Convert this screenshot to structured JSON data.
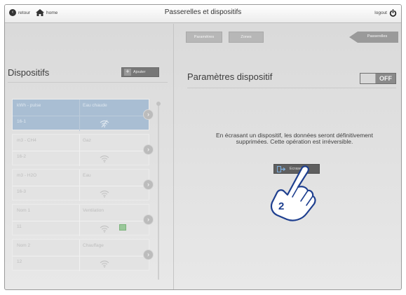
{
  "topbar": {
    "back_label": "retour",
    "back_icon": "chevron-left-circle-icon",
    "home_label": "home",
    "home_icon": "house-icon",
    "title": "Passerelles et dispositifs",
    "logout_label": "logout",
    "logout_icon": "power-icon"
  },
  "tabs": {
    "parametres": "Paramètres",
    "zones": "Zones",
    "passerelles": "Passerelles"
  },
  "left": {
    "title": "Dispositifs",
    "add_label": "Ajouter",
    "add_icon": "plus-icon"
  },
  "devices": [
    {
      "unit": "kWh - pulse",
      "name": "Eau chaude",
      "id": "16-1",
      "selected": true,
      "status_square": false
    },
    {
      "unit": "m3 - CH4",
      "name": "Gaz",
      "id": "16-2",
      "selected": false,
      "status_square": false
    },
    {
      "unit": "m3 - H2O",
      "name": "Eau",
      "id": "16-3",
      "selected": false,
      "status_square": false
    },
    {
      "unit": "Nom 1",
      "name": "Ventilation",
      "id": "11",
      "selected": false,
      "status_square": true
    },
    {
      "unit": "Nom 2",
      "name": "Chauffage",
      "id": "12",
      "selected": false,
      "status_square": false
    }
  ],
  "right": {
    "title": "Paramètres dispositif",
    "toggle_label": "OFF",
    "warning": "En écrasant un dispositif, les données seront définitivement supprimées. Cette opération est irréversible.",
    "erase_label": "Ecraser",
    "erase_icon": "erase-arrow-icon"
  },
  "callout": {
    "step_number": "2"
  },
  "colors": {
    "selected_card": "#a9bed3",
    "card": "#e3e3e3",
    "background": "#e2e2e2",
    "erase_button": "#5f5f5f"
  }
}
